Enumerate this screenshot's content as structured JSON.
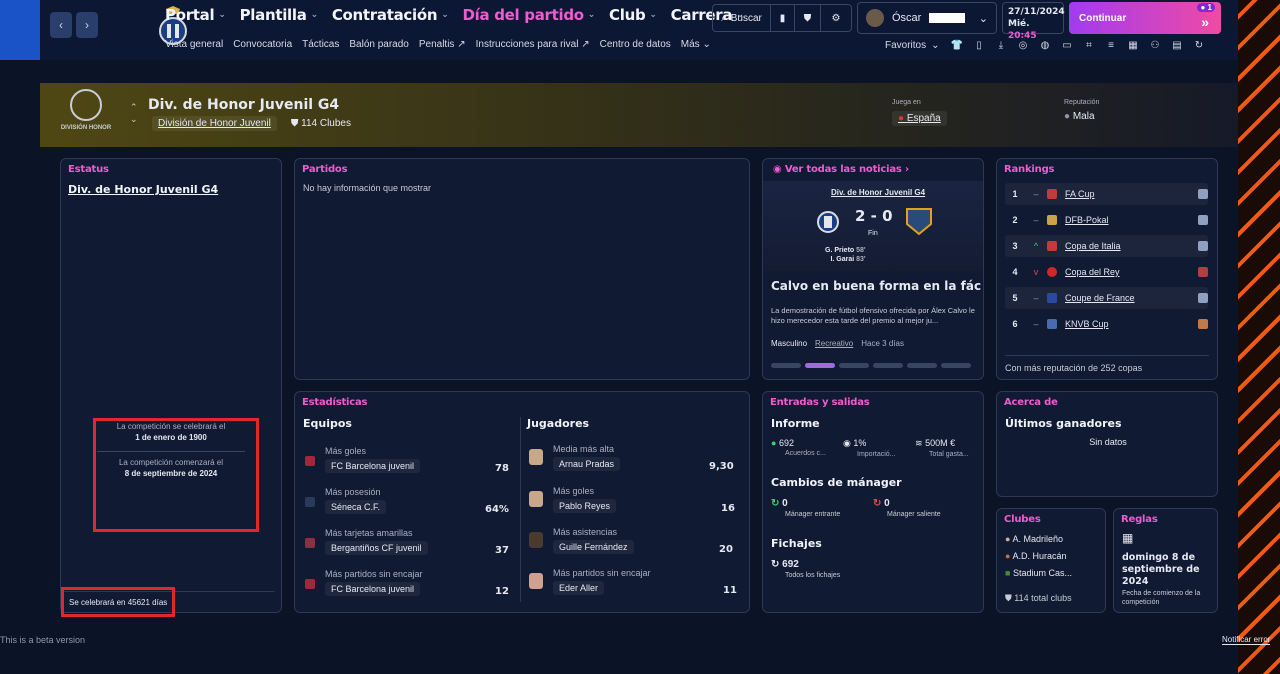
{
  "topbar": {
    "menu": [
      {
        "label": "Portal"
      },
      {
        "label": "Plantilla"
      },
      {
        "label": "Contratación"
      },
      {
        "label": "Día del partido"
      },
      {
        "label": "Club"
      },
      {
        "label": "Carrera"
      }
    ],
    "submenu": [
      "Vista general",
      "Convocatoria",
      "Tácticas",
      "Balón parado",
      "Penaltis",
      "Instrucciones para rival",
      "Centro de datos",
      "Más"
    ],
    "search_label": "Buscar",
    "user_name": "Óscar",
    "date": "27/11/2024",
    "day": "Mié.",
    "time": "20:45",
    "continue_label": "Continuar",
    "notif_count": "1",
    "favorites_label": "Favoritos"
  },
  "competition": {
    "logo_text": "DIVISIÓN HONOR",
    "title": "Div. de Honor Juvenil G4",
    "parent": "División de Honor Juvenil",
    "clubs": "114 Clubes",
    "juega_en_label": "Juega en",
    "juega_en_value": "España",
    "reputacion_label": "Reputación",
    "reputacion_value": "Mala"
  },
  "estatus": {
    "header": "Estatus",
    "name": "Div. de Honor Juvenil G4",
    "line1a": "La competición se celebrará el",
    "line1b": "1 de enero de 1900",
    "line2a": "La competición comenzará el",
    "line2b": "8 de septiembre de 2024",
    "footer": "Se celebrará en 45621 días"
  },
  "partidos": {
    "header": "Partidos",
    "empty": "No hay información que mostrar"
  },
  "news": {
    "header": "Ver todas las noticias",
    "match_comp": "Div. de Honor Juvenil G4",
    "score": "2 - 0",
    "status": "Fin",
    "scorer1": "G. Prieto",
    "scorer1_min": "58'",
    "scorer2": "I. Garai",
    "scorer2_min": "83'",
    "headline": "Calvo en buena forma en la fáci...",
    "body": "La demostración de fútbol ofensivo ofrecida por Álex Calvo le hizo merecedor esta tarde del premio al mejor ju...",
    "tag1": "Masculino",
    "tag2": "Recreativo",
    "ago": "Hace 3 días"
  },
  "rankings": {
    "header": "Rankings",
    "items": [
      {
        "pos": "1",
        "trend": "–",
        "name": "FA Cup"
      },
      {
        "pos": "2",
        "trend": "–",
        "name": "DFB-Pokal"
      },
      {
        "pos": "3",
        "trend": "^",
        "name": "Copa de Italia"
      },
      {
        "pos": "4",
        "trend": "v",
        "name": "Copa del Rey"
      },
      {
        "pos": "5",
        "trend": "–",
        "name": "Coupe de France"
      },
      {
        "pos": "6",
        "trend": "–",
        "name": "KNVB Cup"
      }
    ],
    "footer": "Con más reputación de 252 copas",
    "trend_colors": {
      "up": "#3ccf6a",
      "down": "#e04848",
      "flat": "#8f97ad"
    }
  },
  "stats": {
    "header": "Estadísticas",
    "equipos_title": "Equipos",
    "jugadores_title": "Jugadores",
    "equipos": [
      {
        "label": "Más goles",
        "team": "FC Barcelona juvenil",
        "value": "78"
      },
      {
        "label": "Más posesión",
        "team": "Séneca C.F.",
        "value": "64%"
      },
      {
        "label": "Más tarjetas amarillas",
        "team": "Bergantiños CF juvenil",
        "value": "37"
      },
      {
        "label": "Más partidos sin encajar",
        "team": "FC Barcelona juvenil",
        "value": "12"
      }
    ],
    "jugadores": [
      {
        "label": "Media más alta",
        "player": "Arnau Pradas",
        "value": "9,30"
      },
      {
        "label": "Más goles",
        "player": "Pablo Reyes",
        "value": "16"
      },
      {
        "label": "Más asistencias",
        "player": "Guille Fernández",
        "value": "20"
      },
      {
        "label": "Más partidos sin encajar",
        "player": "Eder Aller",
        "value": "11"
      }
    ]
  },
  "entradas": {
    "header": "Entradas y salidas",
    "informe_title": "Informe",
    "acuerdos_val": "692",
    "acuerdos_lab": "Acuerdos c...",
    "importacion_val": "1%",
    "importacion_lab": "Importació...",
    "total_val": "500M €",
    "total_lab": "Total gasta...",
    "cambios_title": "Cambios de mánager",
    "entrante_val": "0",
    "entrante_lab": "Mánager entrante",
    "saliente_val": "0",
    "saliente_lab": "Mánager saliente",
    "fichajes_title": "Fichajes",
    "fichajes_val": "692",
    "fichajes_lab": "Todos los fichajes"
  },
  "acerca": {
    "header": "Acerca de",
    "title": "Últimos ganadores",
    "empty": "Sin datos"
  },
  "clubes": {
    "header": "Clubes",
    "items": [
      "A. Madrileño",
      "A.D. Huracán",
      "Stadium Cas..."
    ],
    "footer": "114 total clubs"
  },
  "reglas": {
    "header": "Reglas",
    "date": "domingo 8 de septiembre de 2024",
    "caption": "Fecha de comienzo de la competición"
  },
  "footer": {
    "beta": "This is a beta version",
    "report": "Notificar error"
  }
}
